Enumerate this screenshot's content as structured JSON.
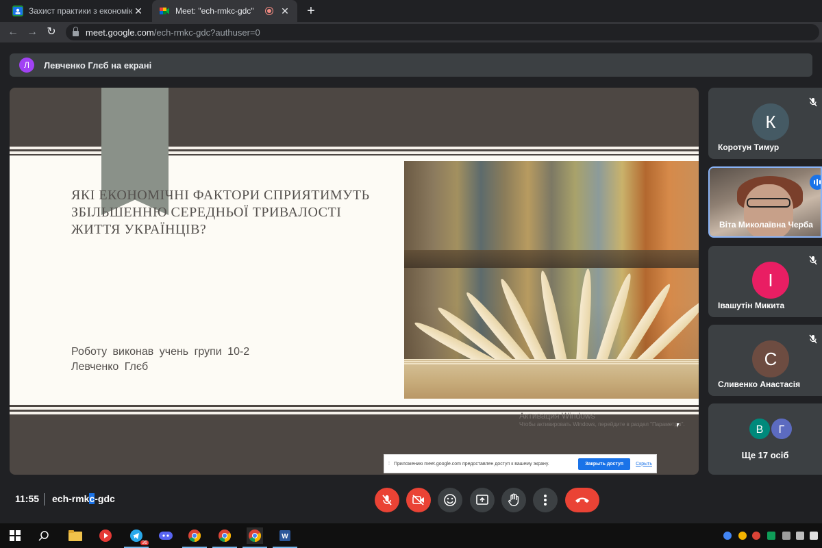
{
  "browser": {
    "tabs": [
      {
        "title": "Захист практики з економіки",
        "icon": "classroom-icon",
        "active": false
      },
      {
        "title": "Meet: \"ech-rmkc-gdc\"",
        "icon": "meet-icon",
        "active": true
      }
    ],
    "url_host": "meet.google.com",
    "url_path": "/ech-rmkc-gdc?authuser=0"
  },
  "presenting_banner": {
    "avatar_letter": "Л",
    "text": "Левченко Глєб на екрані"
  },
  "slide": {
    "title": "ЯКІ ЕКОНОМІЧНІ ФАКТОРИ СПРИЯТИМУТЬ ЗБІЛЬШЕННЮ СЕРЕДНЬОЇ ТРИВАЛОСТІ ЖИТТЯ УКРАЇНЦІВ?",
    "author_line1": "Роботу виконав учень групи 10-2",
    "author_line2": "Левченко Глєб"
  },
  "windows_watermark": {
    "title": "Активация Windows",
    "text": "Чтобы активировать Windows, перейдите в раздел \"Параметры\"."
  },
  "screen_share_bar": {
    "message": "Приложению meet.google.com предоставлен доступ к вашему экрану.",
    "stop_label": "Закрыть доступ",
    "hide_label": "Скрыть"
  },
  "participants": [
    {
      "initial": "К",
      "name": "Коротун Тимур",
      "color": "#455a64",
      "muted": true
    },
    {
      "initial": "",
      "name": "Віта Миколаївна Черба",
      "video": true,
      "speaking": true
    },
    {
      "initial": "І",
      "name": "Івашутін Микита",
      "color": "#e91e63",
      "muted": true
    },
    {
      "initial": "С",
      "name": "Сливенко Анастасія",
      "color": "#6d4c41",
      "muted": true
    }
  ],
  "more_participants": {
    "avatars": [
      {
        "initial": "В",
        "color": "#00897b"
      },
      {
        "initial": "Г",
        "color": "#5c6bc0"
      }
    ],
    "label": "Ще 17 осіб"
  },
  "meeting": {
    "time": "11:55",
    "code_before": "ech-rmk",
    "code_selected": "c",
    "code_after": "-gdc"
  },
  "controls": [
    "mic-off-icon",
    "camera-off-icon",
    "emoji-icon",
    "present-icon",
    "raise-hand-icon",
    "more-options-icon",
    "end-call-icon"
  ],
  "taskbar_apps": [
    "windows-start-icon",
    "search-icon",
    "file-explorer-icon",
    "youtube-icon",
    "telegram-icon",
    "discord-icon",
    "chrome-icon",
    "chrome-icon",
    "chrome-icon",
    "word-icon"
  ],
  "telegram_badge": "36"
}
